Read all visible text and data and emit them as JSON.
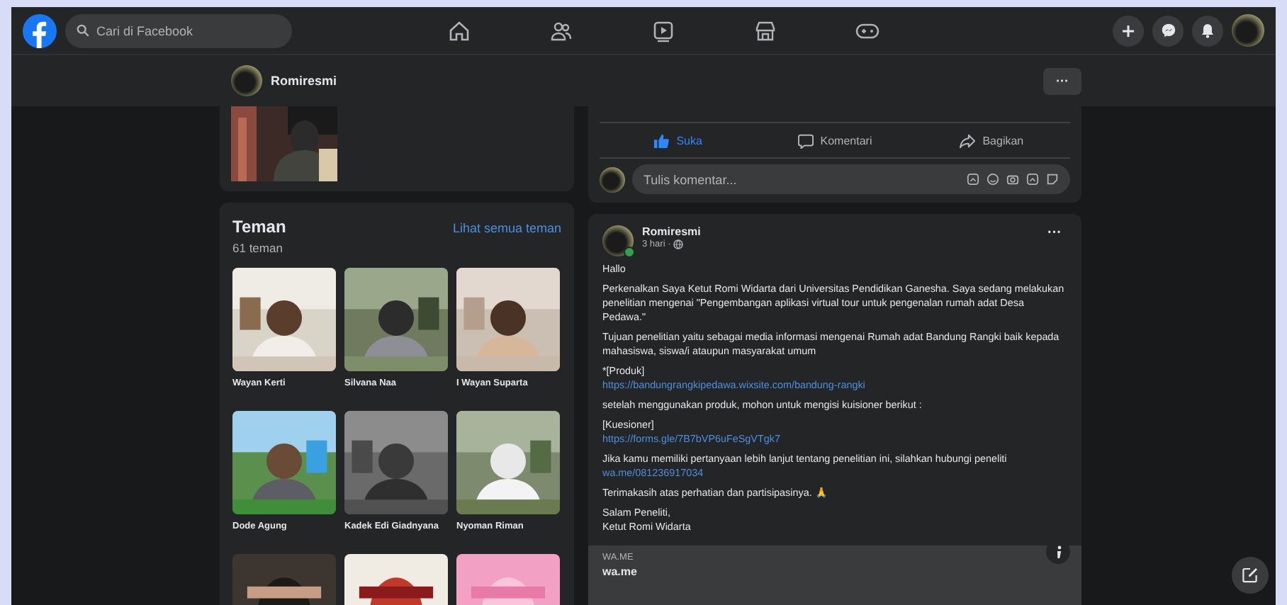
{
  "top_nav": {
    "search": {
      "placeholder": "Cari di Facebook"
    }
  },
  "profile_bar": {
    "name": "Romiresmi",
    "more": "···"
  },
  "previous_post": {
    "actions": [
      {
        "label": "Suka",
        "selected": true
      },
      {
        "label": "Komentari",
        "selected": false
      },
      {
        "label": "Bagikan",
        "selected": false
      }
    ],
    "comment": {
      "placeholder": "Tulis komentar..."
    }
  },
  "friends": {
    "title": "Teman",
    "count": "61 teman",
    "see_all": "Lihat semua teman",
    "items": [
      {
        "name": "Wayan Kerti"
      },
      {
        "name": "Silvana Naa"
      },
      {
        "name": "I Wayan Suparta"
      },
      {
        "name": "Dode Agung"
      },
      {
        "name": "Kadek Edi Giadnyana"
      },
      {
        "name": "Nyoman Riman"
      }
    ]
  },
  "post": {
    "author": "Romiresmi",
    "time": "3 hari ·",
    "online": true,
    "more": "···",
    "paragraphs": [
      {
        "items": [
          {
            "kind": "text",
            "text": "Hallo"
          }
        ]
      },
      {
        "items": [
          {
            "kind": "text",
            "text": "Perkenalkan Saya Ketut Romi Widarta dari Universitas Pendidikan Ganesha. Saya sedang melakukan penelitian mengenai \"Pengembangan aplikasi virtual tour untuk pengenalan rumah adat Desa Pedawa.\""
          }
        ]
      },
      {
        "items": [
          {
            "kind": "text",
            "text": "Tujuan penelitian yaitu sebagai media informasi mengenai Rumah adat Bandung Rangki baik kepada mahasiswa, siswa/i ataupun masyarakat umum"
          }
        ]
      },
      {
        "items": [
          {
            "kind": "text",
            "text": "*[Produk]"
          },
          {
            "kind": "break"
          },
          {
            "kind": "link",
            "text": "https://bandungrangkipedawa.wixsite.com/bandung-rangki"
          }
        ]
      },
      {
        "items": [
          {
            "kind": "text",
            "text": "setelah menggunakan produk, mohon untuk mengisi kuisioner berikut :"
          }
        ]
      },
      {
        "items": [
          {
            "kind": "text",
            "text": "[Kuesioner]"
          },
          {
            "kind": "break"
          },
          {
            "kind": "link",
            "text": "https://forms.gle/7B7bVP6uFeSgVTgk7"
          }
        ]
      },
      {
        "items": [
          {
            "kind": "text",
            "text": "Jika kamu memiliki pertanyaan lebih lanjut tentang penelitian ini, silahkan hubungi peneliti "
          },
          {
            "kind": "link",
            "text": "wa.me/081236917034"
          }
        ]
      },
      {
        "items": [
          {
            "kind": "text",
            "text": "Terimakasih atas perhatian dan partisipasinya. 🙏"
          }
        ]
      },
      {
        "items": [
          {
            "kind": "text",
            "text": "Salam Peneliti,"
          },
          {
            "kind": "break"
          },
          {
            "kind": "text",
            "text": "Ketut Romi Widarta"
          }
        ]
      }
    ],
    "link_preview": {
      "domain": "WA.ME",
      "title": "wa.me"
    }
  }
}
